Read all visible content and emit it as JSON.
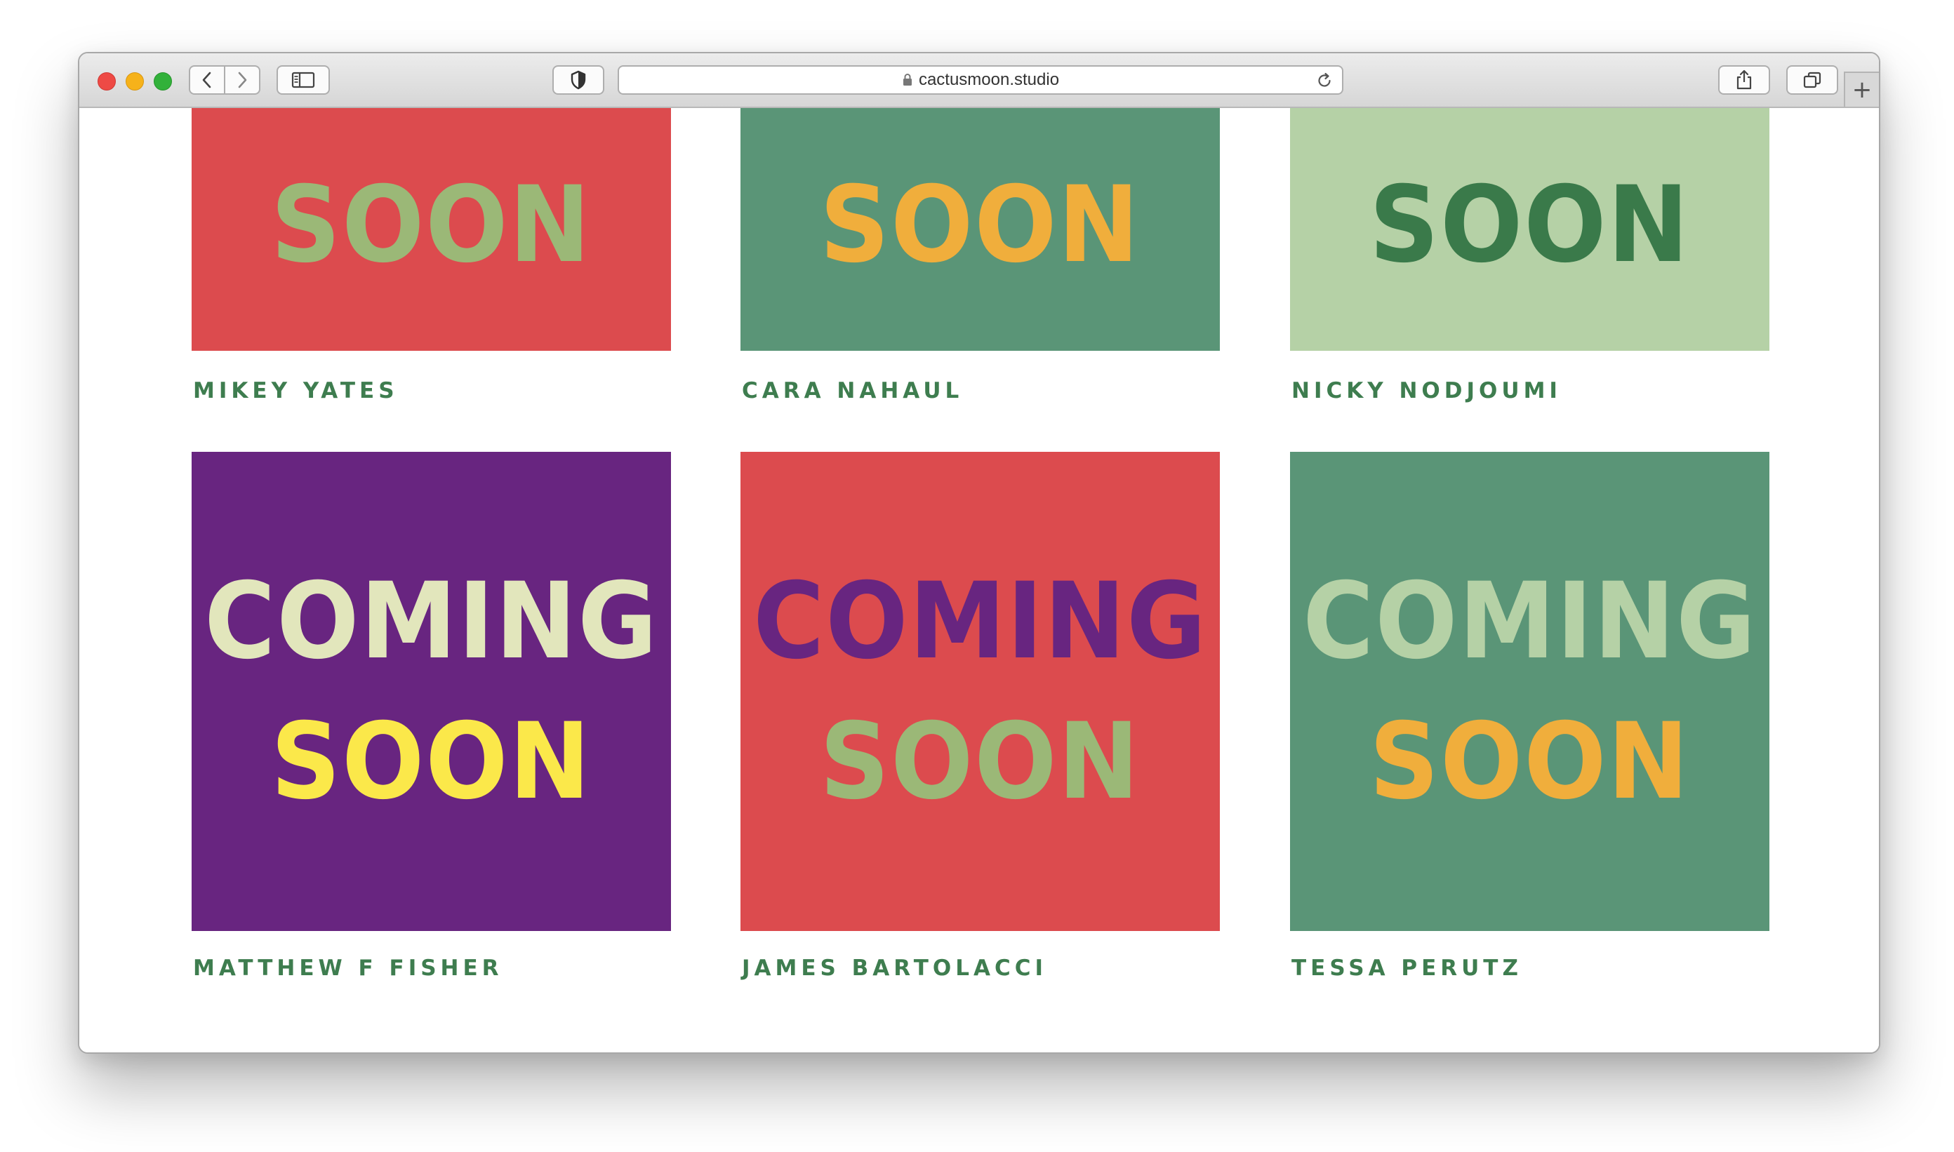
{
  "browser": {
    "url": "cactusmoon.studio"
  },
  "colors": {
    "name_text": "#3e7d4f",
    "red": "#dc4b4e",
    "green": "#5a9577",
    "light_green": "#b5d1a6",
    "purple": "#682580"
  },
  "row1": [
    {
      "name": "MIKEY YATES",
      "line2": "SOON",
      "bg": "#dc4b4e",
      "color2": "#9bb877"
    },
    {
      "name": "CARA NAHAUL",
      "line2": "SOON",
      "bg": "#5a9577",
      "color2": "#f0ae3c"
    },
    {
      "name": "NICKY NODJOUMI",
      "line2": "SOON",
      "bg": "#b5d1a6",
      "color2": "#3a7a4a"
    }
  ],
  "row2": [
    {
      "name": "MATTHEW F FISHER",
      "line1": "COMING",
      "line2": "SOON",
      "bg": "#682580",
      "color1": "#e2e6bc",
      "color2": "#fbe84a"
    },
    {
      "name": "JAMES BARTOLACCI",
      "line1": "COMING",
      "line2": "SOON",
      "bg": "#dc4b4e",
      "color1": "#682580",
      "color2": "#9bb877"
    },
    {
      "name": "TESSA PERUTZ",
      "line1": "COMING",
      "line2": "SOON",
      "bg": "#5a9577",
      "color1": "#b5d1a6",
      "color2": "#f0ae3c"
    }
  ],
  "icons": {
    "back": "chevron-left-icon",
    "forward": "chevron-right-icon",
    "sidebar": "sidebar-icon",
    "privacy": "shield-icon",
    "lock": "lock-icon",
    "reload": "reload-icon",
    "share": "share-icon",
    "tabs": "tabs-icon",
    "new_tab": "plus-icon"
  }
}
